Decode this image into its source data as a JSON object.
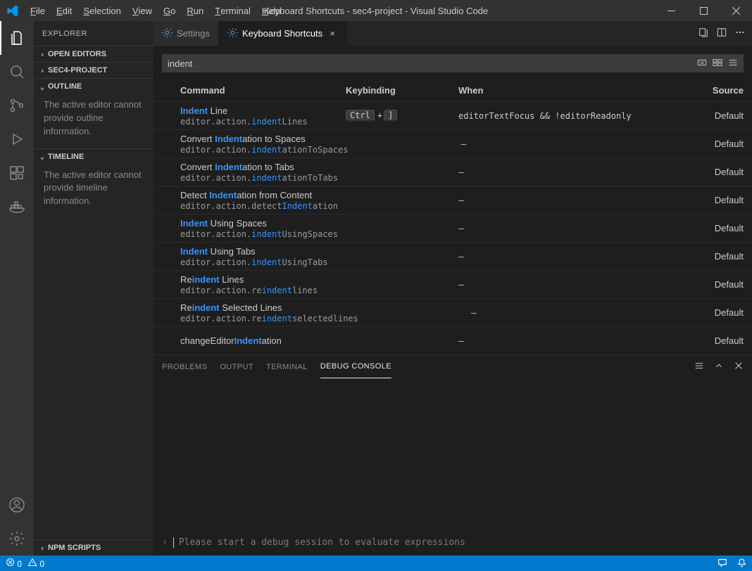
{
  "title": "Keyboard Shortcuts - sec4-project - Visual Studio Code",
  "menus": [
    "File",
    "Edit",
    "Selection",
    "View",
    "Go",
    "Run",
    "Terminal",
    "Help"
  ],
  "sidebar": {
    "title": "EXPLORER",
    "sections": [
      {
        "label": "OPEN EDITORS",
        "expanded": false
      },
      {
        "label": "SEC4-PROJECT",
        "expanded": false
      },
      {
        "label": "OUTLINE",
        "expanded": true,
        "body": "The active editor cannot provide outline information."
      },
      {
        "label": "TIMELINE",
        "expanded": true,
        "body": "The active editor cannot provide timeline information."
      },
      {
        "label": "NPM SCRIPTS",
        "expanded": false
      }
    ]
  },
  "tabs": [
    {
      "label": "Settings",
      "active": false
    },
    {
      "label": "Keyboard Shortcuts",
      "active": true
    }
  ],
  "ks": {
    "search": "indent",
    "headers": {
      "command": "Command",
      "keybinding": "Keybinding",
      "when": "When",
      "source": "Source"
    },
    "rows": [
      {
        "titlePre": "",
        "titleHl": "Indent",
        "titlePost": " Line",
        "subPre": "editor.action.",
        "subHl": "indent",
        "subPost": "Lines",
        "keys": [
          "Ctrl",
          "]"
        ],
        "when": "editorTextFocus && !editorReadonly",
        "source": "Default"
      },
      {
        "titlePre": "Convert ",
        "titleHl": "Indent",
        "titlePost": "ation to Spaces",
        "subPre": "editor.action.",
        "subHl": "indent",
        "subPost": "ationToSpaces",
        "keys": [],
        "when": "—",
        "source": "Default"
      },
      {
        "titlePre": "Convert ",
        "titleHl": "Indent",
        "titlePost": "ation to Tabs",
        "subPre": "editor.action.",
        "subHl": "indent",
        "subPost": "ationToTabs",
        "keys": [],
        "when": "—",
        "source": "Default"
      },
      {
        "titlePre": "Detect ",
        "titleHl": "Indent",
        "titlePost": "ation from Content",
        "subPre": "editor.action.detect",
        "subHl": "Indent",
        "subPost": "ation",
        "keys": [],
        "when": "—",
        "source": "Default"
      },
      {
        "titlePre": "",
        "titleHl": "Indent",
        "titlePost": " Using Spaces",
        "subPre": "editor.action.",
        "subHl": "indent",
        "subPost": "UsingSpaces",
        "keys": [],
        "when": "—",
        "source": "Default"
      },
      {
        "titlePre": "",
        "titleHl": "Indent",
        "titlePost": " Using Tabs",
        "subPre": "editor.action.",
        "subHl": "indent",
        "subPost": "UsingTabs",
        "keys": [],
        "when": "—",
        "source": "Default"
      },
      {
        "titlePre": "Re",
        "titleHl": "indent",
        "titlePost": " Lines",
        "subPre": "editor.action.re",
        "subHl": "indent",
        "subPost": "lines",
        "keys": [],
        "when": "—",
        "source": "Default"
      },
      {
        "titlePre": "Re",
        "titleHl": "indent",
        "titlePost": " Selected Lines",
        "subPre": "editor.action.re",
        "subHl": "indent",
        "subPost": "selectedlines",
        "keys": [],
        "when": "—",
        "source": "Default"
      },
      {
        "titlePre": "changeEditor",
        "titleHl": "Indent",
        "titlePost": "ation",
        "subPre": "",
        "subHl": "",
        "subPost": "",
        "keys": [],
        "when": "—",
        "source": "Default"
      }
    ]
  },
  "panel": {
    "tabs": [
      "PROBLEMS",
      "OUTPUT",
      "TERMINAL",
      "DEBUG CONSOLE"
    ],
    "active": "DEBUG CONSOLE",
    "prompt": "Please start a debug session to evaluate expressions"
  },
  "status": {
    "errors": "0",
    "warnings": "0"
  }
}
